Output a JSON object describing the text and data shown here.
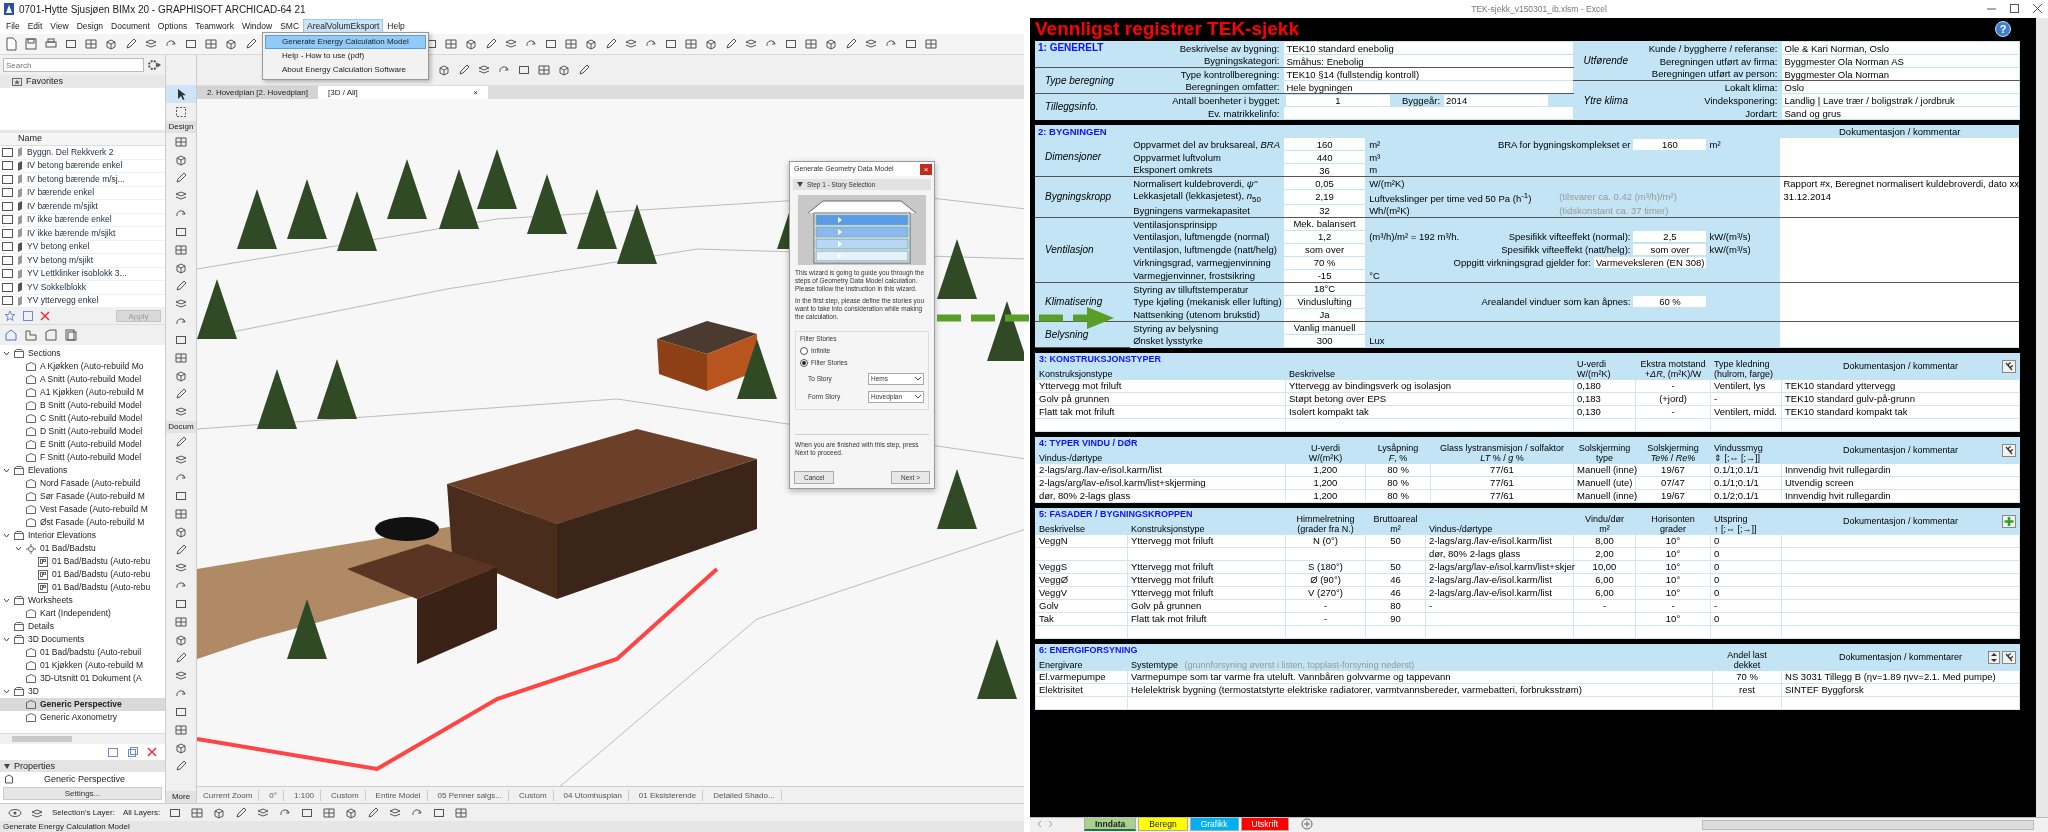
{
  "archicad": {
    "title": "0701-Hytte Sjusjøen BIMx 20 - GRAPHISOFT ARCHICAD-64 21",
    "menu": [
      {
        "label": "File",
        "selected": false
      },
      {
        "label": "Edit",
        "selected": false
      },
      {
        "label": "View",
        "selected": false
      },
      {
        "label": "Design",
        "selected": false
      },
      {
        "label": "Document",
        "selected": false
      },
      {
        "label": "Options",
        "selected": false
      },
      {
        "label": "Teamwork",
        "selected": false
      },
      {
        "label": "Window",
        "selected": false
      },
      {
        "label": "SMC",
        "selected": false
      },
      {
        "label": "ArealVolumEksport",
        "selected": true
      },
      {
        "label": "Help",
        "selected": false
      }
    ],
    "dropdown": [
      {
        "label": "Generate Energy Calculation Model",
        "selected": true
      },
      {
        "label": "Help - How to use (pdf)",
        "selected": false
      },
      {
        "label": "About Energy Calculation Software",
        "selected": false
      }
    ],
    "search": {
      "placeholder": "Search"
    },
    "favorites_title": "Favorites",
    "favorites_column": "Name",
    "favorites": [
      "Byggn. Del Rekkverk 2",
      "IV betong bærende enkel",
      "IV betong bærende m/sj...",
      "IV bærende enkel",
      "IV bærende m/sjikt",
      "IV ikke bærende enkel",
      "IV ikke bærende m/sjikt",
      "YV betong enkel",
      "YV betong m/sjikt",
      "YV Lettklinker isoblokk 3...",
      "YV Sokkelblokk",
      "YV yttervegg enkel"
    ],
    "apply_button": "Apply",
    "navigator": [
      {
        "label": "Sections",
        "kind": "group",
        "expanded": true,
        "selected": false,
        "children": [
          {
            "label": "A Kjøkken (Auto-rebuild Mo",
            "kind": "view",
            "selected": false
          },
          {
            "label": "A Snitt (Auto-rebuild Model",
            "kind": "view",
            "selected": false
          },
          {
            "label": "A1 Kjøkken (Auto-rebuild M",
            "kind": "view",
            "selected": false
          },
          {
            "label": "B Snitt (Auto-rebuild Model",
            "kind": "view",
            "selected": false
          },
          {
            "label": "C Snitt (Auto-rebuild Model",
            "kind": "view",
            "selected": false
          },
          {
            "label": "D Snitt (Auto-rebuild Model",
            "kind": "view",
            "selected": false
          },
          {
            "label": "E Snitt (Auto-rebuild Model",
            "kind": "view",
            "selected": false
          },
          {
            "label": "F Snitt (Auto-rebuild Model",
            "kind": "view",
            "selected": false
          }
        ]
      },
      {
        "label": "Elevations",
        "kind": "group",
        "expanded": true,
        "selected": false,
        "children": [
          {
            "label": "Nord Fasade (Auto-rebuild",
            "kind": "view",
            "selected": false
          },
          {
            "label": "Sør Fasade (Auto-rebuild M",
            "kind": "view",
            "selected": false
          },
          {
            "label": "Vest Fasade (Auto-rebuild M",
            "kind": "view",
            "selected": false
          },
          {
            "label": "Øst Fasade (Auto-rebuild M",
            "kind": "view",
            "selected": false
          }
        ]
      },
      {
        "label": "Interior Elevations",
        "kind": "group",
        "expanded": true,
        "selected": false,
        "children": [
          {
            "label": "01 Bad/Badstu",
            "kind": "marker",
            "expanded": true,
            "selected": false,
            "children": [
              {
                "label": "01 Bad/Badstu (Auto-rebu",
                "kind": "sheet",
                "selected": false
              },
              {
                "label": "01 Bad/Badstu (Auto-rebu",
                "kind": "sheet",
                "selected": false
              },
              {
                "label": "01 Bad/Badstu (Auto-rebu",
                "kind": "sheet",
                "selected": false
              }
            ]
          }
        ]
      },
      {
        "label": "Worksheets",
        "kind": "group",
        "expanded": true,
        "selected": false,
        "children": [
          {
            "label": "Kart (Independent)",
            "kind": "view",
            "selected": false
          }
        ]
      },
      {
        "label": "Details",
        "kind": "group",
        "selected": false
      },
      {
        "label": "3D Documents",
        "kind": "group",
        "expanded": true,
        "selected": false,
        "children": [
          {
            "label": "01 Bad/badstu (Auto-rebuil",
            "kind": "view",
            "selected": false
          },
          {
            "label": "01 Kjøkken (Auto-rebuild M",
            "kind": "view",
            "selected": false
          },
          {
            "label": "3D-Utsnitt 01 Dokument (A",
            "kind": "view",
            "selected": false
          }
        ]
      },
      {
        "label": "3D",
        "kind": "group",
        "expanded": true,
        "selected": false,
        "children": [
          {
            "label": "Generic Perspective",
            "kind": "view",
            "selected": true
          },
          {
            "label": "Generic Axonometry",
            "kind": "view",
            "selected": false
          }
        ]
      }
    ],
    "properties": {
      "title": "Properties",
      "value": "Generic Perspective",
      "button": "Settings..."
    },
    "toolbox": {
      "sections": [
        "Design",
        "Docum"
      ],
      "more": "More"
    },
    "view_tabs": [
      {
        "label": "2. Hovedplan [2. Hovedplan]",
        "selected": false
      },
      {
        "label": "[3D / All]",
        "selected": true,
        "close": "×"
      }
    ],
    "status_row": [
      "Current Zoom",
      "0°",
      "1:100",
      "Custom",
      "Entire Model",
      "05 Penner salgs...",
      "Custom",
      "04 Utomhusplan",
      "01 Eksisterende",
      "Detailed Shado..."
    ],
    "layer_labels": [
      "Selection's Layer:",
      "All Layers:"
    ],
    "status_text": "Generate Energy Calculation Model",
    "dialog": {
      "title": "Generate Geometry Data Model",
      "close": "×",
      "step": "Step 1 - Story Selection",
      "intro": [
        "This wizard is going to guide you through the steps of Geometry Data Model calculation. Please follow the instruction in this wizard.",
        "In the first step, please define the stories you want to take into consideration while making the calculation."
      ],
      "filter_title": "Filter Stories",
      "options": [
        {
          "label": "Infinite",
          "selected": false
        },
        {
          "label": "Filter Stories",
          "selected": true
        }
      ],
      "fields": [
        {
          "label": "To Story",
          "value": "Hems"
        },
        {
          "label": "Form Story",
          "value": "Hovedplan"
        }
      ],
      "footer": "When you are finished with this step, press Next to proceed.",
      "buttons": [
        "Cancel",
        "Next >"
      ]
    }
  },
  "excel": {
    "title": "TEK-sjekk_v150301_ib.xlsm - Excel",
    "heading": "Vennligst registrer TEK-sjekk",
    "help": "?",
    "general": {
      "title": "1: GENERELT",
      "left": [
        {
          "rows": [
            {
              "label": "Beskrivelse av bygning:",
              "value": "TEK10 standard enebolig"
            },
            {
              "label": "Bygningskategori:",
              "value": "Småhus: Enebolig"
            }
          ]
        },
        {
          "group": "Type beregning",
          "rows": [
            {
              "label": "Type kontrollberegning:",
              "value": "TEK10 §14 (fullstendig kontroll)"
            },
            {
              "label": "Beregningen omfatter:",
              "value": "Hele bygningen"
            }
          ]
        },
        {
          "group": "Tilleggsinfo.",
          "rows": [
            {
              "label": "Antall boenheter i bygget:",
              "value": "1",
              "extra_label": "Byggeår:",
              "extra_value": "2014"
            },
            {
              "label": "Ev. matrikkelinfo:"
            }
          ]
        }
      ],
      "right": [
        {
          "group": "Utførende",
          "rows": [
            {
              "label": "Kunde / byggherre / referanse:",
              "value": "Ole & Kari Norman, Oslo"
            },
            {
              "label": "Beregningen utført av firma:",
              "value": "Byggmester Ola Norman AS"
            },
            {
              "label": "Beregningen utført av person:",
              "value": "Byggmester Ola Norman"
            }
          ]
        },
        {
          "group": "Ytre klima",
          "rows": [
            {
              "label": "Lokalt klima:",
              "value": "Oslo"
            },
            {
              "label": "Vindeksponering:",
              "value": "Landlig | Lave trær / boligstrøk / jordbruk"
            },
            {
              "label": "Jordart:",
              "value": "Sand og grus"
            }
          ]
        }
      ]
    },
    "building": {
      "title": "2: BYGNINGEN",
      "comment_header": "Dokumentasjon / kommentar",
      "groups": [
        {
          "group": "Dimensjoner",
          "rows": [
            {
              "label": "Oppvarmet del av bruksareal, *BRA*",
              "value": "160",
              "unit": "m²",
              "mid_label": "BRA for bygningskomplekset er",
              "mid_value": "160",
              "mid_unit": "m²"
            },
            {
              "label": "Oppvarmet luftvolum",
              "value": "440",
              "unit": "m³"
            },
            {
              "label": "Eksponert omkrets",
              "value": "36",
              "unit": "m"
            }
          ]
        },
        {
          "group": "Bygningskropp",
          "rows": [
            {
              "label": "Normalisert kuldebroverdi, *ψ''*",
              "value": "0,05",
              "unit": "W/(m²K)",
              "comment": "Rapport #x, Beregnet normalisert kuldebroverdi, dato xx"
            },
            {
              "label": "Lekkasjetall (lekkasjetest), *n*$_{50}$",
              "value": "2,19",
              "unit": "Luftvekslinger per time ved 50 Pa (h$^{-1}$)",
              "note": "(tilsvarer ca. 0.42 (m³/h)/m²)",
              "comment": "31.12.2014"
            },
            {
              "label": "Bygningens varmekapasitet",
              "value": "32",
              "unit": "Wh/(m²K)",
              "note": "(tidskonstant ca. 37 timer)"
            }
          ]
        },
        {
          "group": "Ventilasjon",
          "rows": [
            {
              "label": "Ventilasjonsprinsipp",
              "value": "Mek. balansert"
            },
            {
              "label": "Ventilasjon, luftmengde (normal)",
              "value": "1,2",
              "unit": "(m³/h)/m² = 192 m³/h.",
              "mid_label": "Spesifikk vifteeffekt (normal):",
              "mid_value": "2,5",
              "mid_unit": "kW/(m³/s)"
            },
            {
              "label": "Ventilasjon, luftmengde (natt/helg)",
              "value": "som over",
              "mid_label": "Spesifikk vifteeffekt (natt/helg):",
              "mid_value": "som over",
              "mid_unit": "kW/(m³/s)"
            },
            {
              "label": "Virkningsgrad, varmegjenvinning",
              "value": "70 %",
              "mid_label": "Oppgitt virkningsgrad gjelder for:",
              "mid_value": "Varmeveksleren (EN 308)"
            },
            {
              "label": "Varmegjenvinner, frostsikring",
              "value": "-15",
              "unit": "°C"
            }
          ]
        },
        {
          "group": "Klimatisering",
          "rows": [
            {
              "label": "Styring av tilluftstemperatur",
              "value": "18°C"
            },
            {
              "label": "Type kjøling (mekanisk eller lufting)",
              "value": "Vinduslufting",
              "mid_label": "Arealandel vinduer som kan åpnes:",
              "mid_value": "60 %"
            },
            {
              "label": "Nattsenking (utenom brukstid)",
              "value": "Ja"
            }
          ]
        },
        {
          "group": "Belysning",
          "rows": [
            {
              "label": "Styring av belysning",
              "value": "Vanlig manuell"
            },
            {
              "label": "Ønsket lysstyrke",
              "value": "300",
              "unit": "Lux"
            }
          ]
        }
      ]
    },
    "tables": [
      {
        "kind": "constructions",
        "title": "3: KONSTRUKSJONSTYPER",
        "tools": [
          {
            "kind": "wrench"
          }
        ],
        "columns": [
          "Konstruksjonstype",
          "Beskrivelse",
          "U-verdi\nW/(m²K)",
          "Ekstra motstand\n+*ΔR*, (m²K)/W",
          "Type kledning\n(hulrom, farge)",
          "Dokumentasjon / kommentar"
        ],
        "rows": [
          [
            "Yttervegg mot friluft",
            "Yttervegg av bindingsverk og isolasjon",
            "0,180",
            "-",
            "Ventilert, lys",
            "TEK10 standard yttervegg"
          ],
          [
            "Golv på grunnen",
            "Støpt betong over EPS",
            "0,183",
            "(+jord)",
            "-",
            "TEK10 standard gulv-på-grunn"
          ],
          [
            "Flatt tak mot friluft",
            "Isolert kompakt tak",
            "0,130",
            "-",
            "Ventilert, midd.",
            "TEK10 standard kompakt tak"
          ]
        ]
      },
      {
        "kind": "windows",
        "title": "4: TYPER VINDU / DØR",
        "tools": [
          {
            "kind": "wrench"
          }
        ],
        "columns": [
          "Vindus-/dørtype",
          "U-verdi\nW/(m²K)",
          "Lysåpning\n*F*, %",
          "Glass lystransmisjon / solfaktor\n*LT* % / *g* %",
          "Solskjerming\ntype",
          "Solskjerming\n*Te%* / *Re%*",
          "Vindussmyg\n⇕ [;⇔ [;→]]",
          "Dokumentasjon / kommentar"
        ],
        "rows": [
          [
            "2-lags/arg./lav-e/isol.karm/list",
            "1,200",
            "80 %",
            "77/61",
            "Manuell (inne)",
            "19/67",
            "0.1/1;0.1/1",
            "Innvendig hvit rullegardin"
          ],
          [
            "2-lags/arg/lav-e/isol.karm/list+skjerming",
            "1,200",
            "80 %",
            "77/61",
            "Manuell (ute)",
            "07/47",
            "0.1/1;0.1/1",
            "Utvendig screen"
          ],
          [
            "dør, 80% 2-lags glass",
            "1,200",
            "80 %",
            "77/61",
            "Manuell (inne)",
            "19/67",
            "0.1/2;0.1/1",
            "Innvendig hvit rullegardin"
          ]
        ]
      },
      {
        "kind": "facades",
        "title": "5: FASADER / BYGNINGSKROPPEN",
        "tools": [
          {
            "kind": "plus"
          }
        ],
        "columns": [
          "Beskrivelse",
          "Konstruksjonstype",
          "Himmelretning\n(grader fra N.)",
          "Bruttoareal\nm²",
          "Vindus-/dørtype",
          "Vindu/dør\nm²",
          "Horisonten\ngrader",
          "Utspring\n↑ [;⇔ [;→]]",
          "Dokumentasjon / kommentar"
        ],
        "rows": [
          [
            "VeggN",
            "Yttervegg mot friluft",
            "N (0°)",
            "50",
            "2-lags/arg./lav-e/isol.karm/list",
            "8,00",
            "10°",
            "0",
            null
          ],
          [
            null,
            null,
            null,
            null,
            "dør, 80% 2-lags glass",
            "2,00",
            "10°",
            "0",
            null
          ],
          [
            "VeggS",
            "Yttervegg mot friluft",
            "S (180°)",
            "50",
            "2-lags/arg/lav-e/isol.karm/list+skjer",
            "10,00",
            "10°",
            "0",
            null
          ],
          [
            "VeggØ",
            "Yttervegg mot friluft",
            "Ø (90°)",
            "46",
            "2-lags/arg./lav-e/isol.karm/list",
            "6,00",
            "10°",
            "0",
            null
          ],
          [
            "VeggV",
            "Yttervegg mot friluft",
            "V (270°)",
            "46",
            "2-lags/arg./lav-e/isol.karm/list",
            "6,00",
            "10°",
            "0",
            null
          ],
          [
            "Golv",
            "Golv på grunnen",
            "-",
            "80",
            "-",
            "-",
            "-",
            "-",
            null
          ],
          [
            "Tak",
            "Flatt tak mot friluft",
            "-",
            "90",
            null,
            null,
            "10°",
            "0",
            null
          ]
        ]
      },
      {
        "kind": "energy",
        "title": "6: ENERGIFORSYNING",
        "tools": [
          {
            "kind": "spinner"
          },
          {
            "kind": "wrench"
          }
        ],
        "columns": [
          "Energivare",
          {
            "label": "Systemtype",
            "note": "(grunnforsyning øverst i listen, topplast-forsyning nederst)"
          },
          "Andel last\ndekket",
          "Dokumentasjon / kommentarer"
        ],
        "rows": [
          [
            "El.varmepumpe",
            "Varmepumpe som tar varme fra uteluft. Vannbåren golvvarme og tappevann",
            "70 %",
            "NS 3031 Tillegg B (ηv=1.89 ηvv=2.1. Med pumpe)"
          ],
          [
            "Elektrisitet",
            "Helelektrisk bygning (termostatstyrte elektriske radiatorer, varmtvannsbereder, varmebatteri, forbruksstrøm)",
            "rest",
            "SINTEF Byggforsk"
          ]
        ]
      }
    ],
    "sheets": [
      {
        "label": "Inndata",
        "color": "#a9d08e",
        "selected": true
      },
      {
        "label": "Beregn",
        "color": "#ffff00",
        "selected": false
      },
      {
        "label": "Grafikk",
        "color": "#00b0f0",
        "selected": false
      },
      {
        "label": "Utskrift",
        "color": "#ff0000",
        "selected": false
      }
    ]
  }
}
